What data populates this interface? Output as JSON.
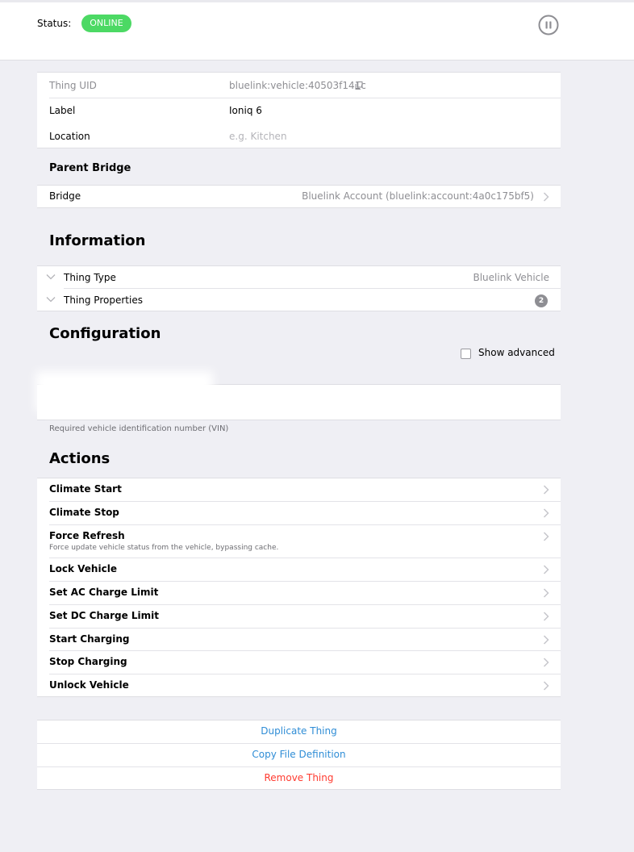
{
  "status": {
    "label": "Status:",
    "badge": "ONLINE",
    "badge_color": "#4cd964",
    "pause_icon": "pause-circle-icon"
  },
  "thing": {
    "uid_label": "Thing UID",
    "uid_value": "bluelink:vehicle:40503f141c",
    "copy_icon": "copy-icon",
    "label_label": "Label",
    "label_value": "Ioniq 6",
    "location_label": "Location",
    "location_placeholder": "e.g. Kitchen"
  },
  "parent_bridge": {
    "title": "Parent Bridge",
    "bridge_label": "Bridge",
    "bridge_value": "Bluelink Account (bluelink:account:4a0c175bf5)"
  },
  "information": {
    "title": "Information",
    "thing_type_label": "Thing Type",
    "thing_type_value": "Bluelink Vehicle",
    "properties_label": "Thing Properties",
    "properties_count": "2"
  },
  "configuration": {
    "title": "Configuration",
    "show_advanced": "Show advanced",
    "hint": "Required vehicle identification number (VIN)"
  },
  "actions": {
    "title": "Actions",
    "items": [
      {
        "title": "Climate Start"
      },
      {
        "title": "Climate Stop"
      },
      {
        "title": "Force Refresh",
        "desc": "Force update vehicle status from the vehicle, bypassing cache."
      },
      {
        "title": "Lock Vehicle"
      },
      {
        "title": "Set AC Charge Limit"
      },
      {
        "title": "Set DC Charge Limit"
      },
      {
        "title": "Start Charging"
      },
      {
        "title": "Stop Charging"
      },
      {
        "title": "Unlock Vehicle"
      }
    ]
  },
  "buttons": {
    "duplicate": "Duplicate Thing",
    "copy_file": "Copy File Definition",
    "remove": "Remove Thing",
    "link_color": "#2f8dd6",
    "danger_color": "#ff3b30"
  }
}
